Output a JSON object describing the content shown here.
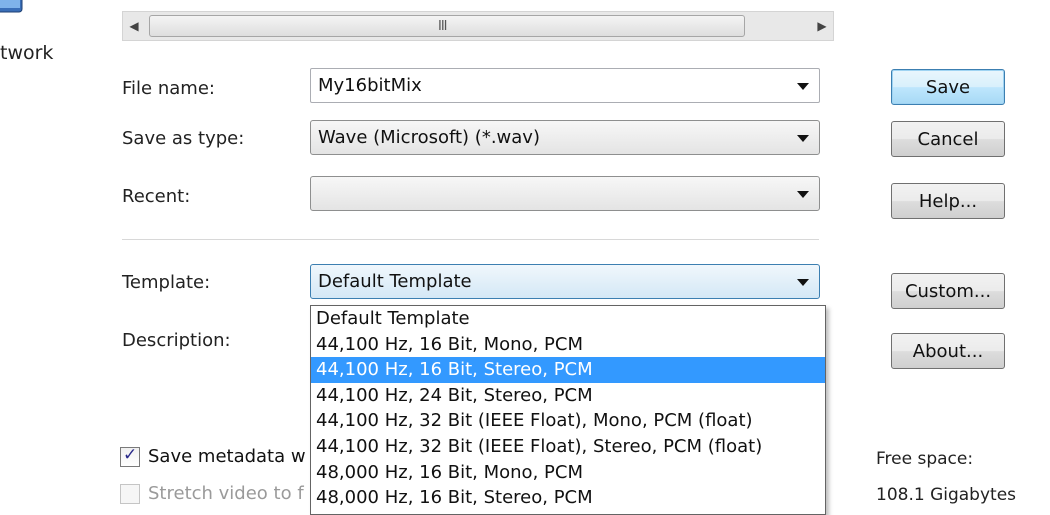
{
  "nav": {
    "partial_label": "twork",
    "icon": "network-icon"
  },
  "scrollbar": {
    "left_arrow": "◀",
    "right_arrow": "▶",
    "grip": "III"
  },
  "form": {
    "file_name_label": "File name:",
    "file_name_value": "My16bitMix",
    "save_as_type_label": "Save as type:",
    "save_as_type_value": "Wave (Microsoft) (*.wav)",
    "recent_label": "Recent:",
    "recent_value": "",
    "template_label": "Template:",
    "template_value": "Default Template",
    "description_label": "Description:"
  },
  "buttons": {
    "save": "Save",
    "cancel": "Cancel",
    "help": "Help...",
    "custom": "Custom...",
    "about": "About..."
  },
  "template_options": [
    "Default Template",
    "44,100 Hz, 16 Bit, Mono, PCM",
    "44,100 Hz, 16 Bit, Stereo, PCM",
    "44,100 Hz, 24 Bit, Stereo, PCM",
    "44,100 Hz, 32 Bit (IEEE Float), Mono, PCM (float)",
    "44,100 Hz, 32 Bit (IEEE Float), Stereo, PCM (float)",
    "48,000 Hz, 16 Bit, Mono, PCM",
    "48,000 Hz, 16 Bit, Stereo, PCM"
  ],
  "template_selected_index": 2,
  "options": {
    "save_metadata_label": "Save metadata w",
    "save_metadata_checked": true,
    "stretch_video_label": "Stretch video to f",
    "stretch_video_checked": false
  },
  "free_space": {
    "label": "Free space:",
    "value": "108.1 Gigabytes"
  },
  "colors": {
    "selection": "#3399ff",
    "focus_border": "#3c7fb1"
  }
}
